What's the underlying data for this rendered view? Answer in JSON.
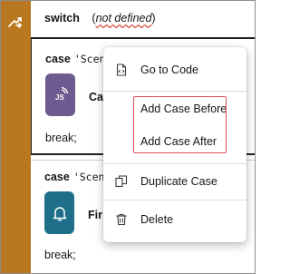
{
  "switch_header": {
    "keyword": "switch",
    "open_paren": "(",
    "condition": "not defined",
    "close_paren": ")"
  },
  "cases": [
    {
      "keyword": "case",
      "value": "'Scena",
      "step_name": "Ca",
      "step_icon": "javascript-icon",
      "tile_color": "#6d5a8f",
      "break_text": "break;"
    },
    {
      "keyword": "case",
      "value": "'Scena",
      "step_name": "Fir",
      "step_icon": "bell-icon",
      "tile_color": "#1f6f8b",
      "break_text": "break;"
    }
  ],
  "context_menu": {
    "items": [
      {
        "label": "Go to Code",
        "icon": "code-file-icon"
      },
      {
        "label": "Add Case Before",
        "icon": ""
      },
      {
        "label": "Add Case After",
        "icon": ""
      },
      {
        "label": "Duplicate Case",
        "icon": "copy-icon"
      },
      {
        "label": "Delete",
        "icon": "trash-icon"
      }
    ],
    "highlight_color": "#e0525a"
  },
  "colors": {
    "rail": "#b9781f",
    "text": "#161513"
  }
}
